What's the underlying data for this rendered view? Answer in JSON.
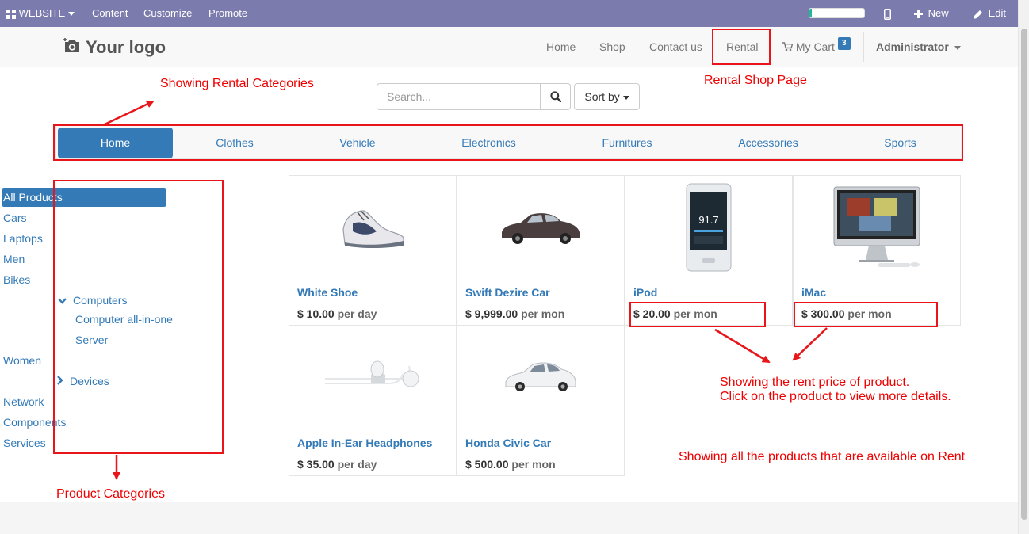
{
  "admin_bar": {
    "website_label": "WEBSITE",
    "menu": [
      "Content",
      "Customize",
      "Promote"
    ],
    "new_label": "New",
    "edit_label": "Edit",
    "progress_value": 0.05
  },
  "header": {
    "logo_text": "Your logo",
    "nav": [
      "Home",
      "Shop",
      "Contact us",
      "Rental"
    ],
    "cart_label": "My Cart",
    "cart_count": "3",
    "user_label": "Administrator"
  },
  "search": {
    "placeholder": "Search...",
    "sort_label": "Sort by"
  },
  "rental_categories": [
    "Home",
    "Clothes",
    "Vehicle",
    "Electronics",
    "Furnitures",
    "Accessories",
    "Sports"
  ],
  "product_categories": [
    {
      "label": "All Products"
    },
    {
      "label": "Cars"
    },
    {
      "label": "Laptops"
    },
    {
      "label": "Men"
    },
    {
      "label": "Bikes"
    },
    {
      "label": "Computers"
    },
    {
      "label": "Computer all-in-one"
    },
    {
      "label": "Server"
    },
    {
      "label": "Women"
    },
    {
      "label": "Devices"
    },
    {
      "label": "Network"
    },
    {
      "label": "Components"
    },
    {
      "label": "Services"
    }
  ],
  "products": [
    {
      "name": "White Shoe",
      "price": "$ 10.00",
      "unit": "per day"
    },
    {
      "name": "Swift Dezire Car",
      "price": "$ 9,999.00",
      "unit": "per mon"
    },
    {
      "name": "iPod",
      "price": "$ 20.00",
      "unit": "per mon"
    },
    {
      "name": "iMac",
      "price": "$ 300.00",
      "unit": "per mon"
    },
    {
      "name": "Apple In-Ear Headphones",
      "price": "$ 35.00",
      "unit": "per day"
    },
    {
      "name": "Honda Civic Car",
      "price": "$ 500.00",
      "unit": "per mon"
    }
  ],
  "ipod_display": "91.7",
  "annotations": {
    "rental_categories": "Showing Rental Categories",
    "rental_shop_page": "Rental Shop Page",
    "rent_price_line1": "Showing the rent price of product.",
    "rent_price_line2": "Click on the product to view more details.",
    "all_products": "Showing all the products that are available on Rent",
    "product_categories": "Product Categories"
  },
  "colors": {
    "admin_bar": "#7c7bad",
    "link": "#337ab7",
    "annotation": "#e8151b",
    "progress": "#21b799"
  }
}
